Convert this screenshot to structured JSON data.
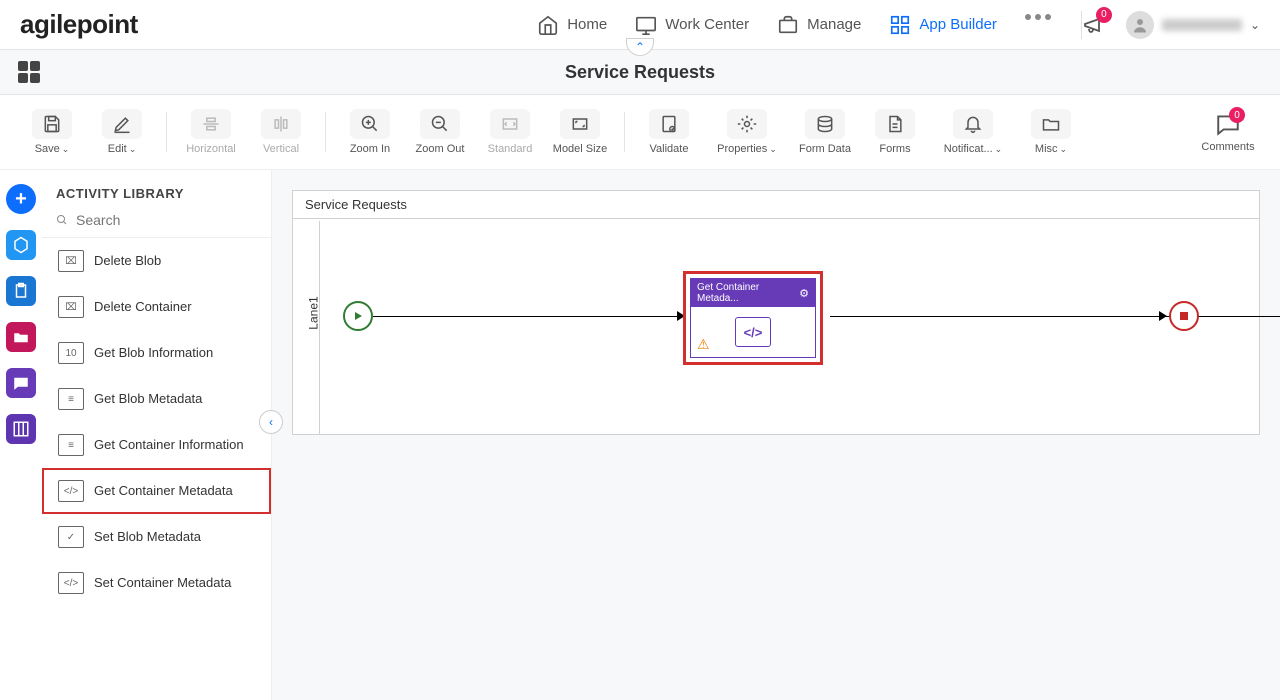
{
  "header": {
    "logo": "agilepoint",
    "nav": [
      {
        "label": "Home",
        "icon": "home-icon"
      },
      {
        "label": "Work Center",
        "icon": "monitor-icon"
      },
      {
        "label": "Manage",
        "icon": "briefcase-icon"
      },
      {
        "label": "App Builder",
        "icon": "grid-icon",
        "active": true
      }
    ],
    "notif_count": "0",
    "user_name": "(redacted)"
  },
  "subheader": {
    "title": "Service Requests"
  },
  "toolbar": {
    "save": "Save",
    "edit": "Edit",
    "horizontal": "Horizontal",
    "vertical": "Vertical",
    "zoom_in": "Zoom In",
    "zoom_out": "Zoom Out",
    "standard": "Standard",
    "model_size": "Model Size",
    "validate": "Validate",
    "properties": "Properties",
    "form_data": "Form Data",
    "forms": "Forms",
    "notifications": "Notificat...",
    "misc": "Misc",
    "comments": "Comments",
    "comments_count": "0"
  },
  "sidebar": {
    "title": "ACTIVITY LIBRARY",
    "search_placeholder": "Search",
    "items": [
      {
        "label": "Delete Blob"
      },
      {
        "label": "Delete Container"
      },
      {
        "label": "Get Blob Information"
      },
      {
        "label": "Get Blob Metadata"
      },
      {
        "label": "Get Container Information"
      },
      {
        "label": "Get Container Metadata",
        "selected": true
      },
      {
        "label": "Set Blob Metadata"
      },
      {
        "label": "Set Container Metadata"
      }
    ]
  },
  "canvas": {
    "title": "Service Requests",
    "lane": "Lane1",
    "activity": {
      "title": "Get Container Metada..."
    }
  }
}
